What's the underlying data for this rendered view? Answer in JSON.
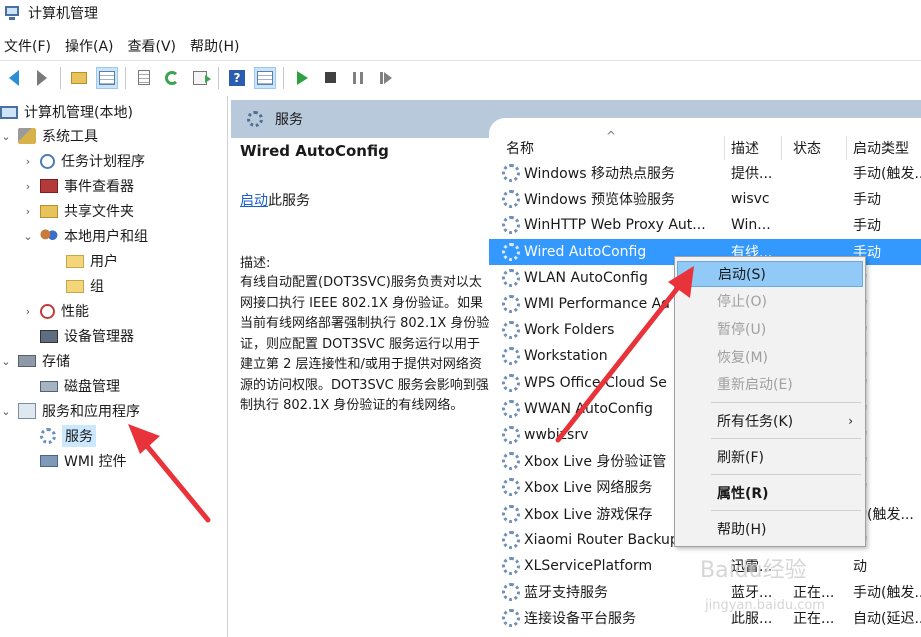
{
  "window": {
    "title": "计算机管理"
  },
  "menu": [
    "文件(F)",
    "操作(A)",
    "查看(V)",
    "帮助(H)"
  ],
  "tree": {
    "root": "计算机管理(本地)",
    "system_tools": "系统工具",
    "task_scheduler": "任务计划程序",
    "event_viewer": "事件查看器",
    "shared_folders": "共享文件夹",
    "local_users": "本地用户和组",
    "users": "用户",
    "groups": "组",
    "performance": "性能",
    "device_manager": "设备管理器",
    "storage": "存储",
    "disk_management": "磁盘管理",
    "services_apps": "服务和应用程序",
    "services": "服务",
    "wmi": "WMI 控件"
  },
  "header": {
    "title": "服务"
  },
  "detail": {
    "name": "Wired AutoConfig",
    "start_link": "启动",
    "start_suffix": "此服务",
    "desc_label": "描述:",
    "desc": "有线自动配置(DOT3SVC)服务负责对以太网接口执行 IEEE 802.1X 身份验证。如果当前有线网络部署强制执行 802.1X 身份验证，则应配置 DOT3SVC 服务运行以用于建立第 2 层连接性和/或用于提供对网络资源的访问权限。DOT3SVC 服务会影响到强制执行 802.1X 身份验证的有线网络。"
  },
  "columns": {
    "name": "名称",
    "desc": "描述",
    "status": "状态",
    "startup": "启动类型"
  },
  "services": [
    {
      "name": "Windows 移动热点服务",
      "desc": "提供...",
      "status": "",
      "startup": "手动(触发..."
    },
    {
      "name": "Windows 预览体验服务",
      "desc": "wisvc",
      "status": "",
      "startup": "手动"
    },
    {
      "name": "WinHTTP Web Proxy Aut...",
      "desc": "Win...",
      "status": "",
      "startup": "手动"
    },
    {
      "name": "Wired AutoConfig",
      "desc": "有线...",
      "status": "",
      "startup": "手动"
    },
    {
      "name": "WLAN AutoConfig",
      "desc": "",
      "status": "",
      "startup": "动"
    },
    {
      "name": "WMI Performance Ad",
      "desc": "",
      "status": "",
      "startup": "动"
    },
    {
      "name": "Work Folders",
      "desc": "",
      "status": "",
      "startup": "动"
    },
    {
      "name": "Workstation",
      "desc": "",
      "status": "",
      "startup": "动"
    },
    {
      "name": "WPS Office Cloud Se",
      "desc": "",
      "status": "",
      "startup": "动"
    },
    {
      "name": "WWAN AutoConfig",
      "desc": "",
      "status": "",
      "startup": "动"
    },
    {
      "name": "wwbizsrv",
      "desc": "",
      "status": "",
      "startup": "动"
    },
    {
      "name": "Xbox Live 身份验证管",
      "desc": "",
      "status": "",
      "startup": "动"
    },
    {
      "name": "Xbox Live 网络服务",
      "desc": "",
      "status": "",
      "startup": "动"
    },
    {
      "name": "Xbox Live 游戏保存",
      "desc": "",
      "status": "",
      "startup": "动(触发..."
    },
    {
      "name": "Xiaomi Router Backup",
      "desc": "",
      "status": "",
      "startup": "动"
    },
    {
      "name": "XLServicePlatform",
      "desc": "迅雷...",
      "status": "",
      "startup": "动"
    },
    {
      "name": "蓝牙支持服务",
      "desc": "蓝牙...",
      "status": "正在...",
      "startup": "手动(触发..."
    },
    {
      "name": "连接设备平台服务",
      "desc": "此服...",
      "status": "正在...",
      "startup": "自动(延迟..."
    }
  ],
  "context_menu": {
    "start": "启动(S)",
    "stop": "停止(O)",
    "pause": "暂停(U)",
    "resume": "恢复(M)",
    "restart": "重新启动(E)",
    "all_tasks": "所有任务(K)",
    "refresh": "刷新(F)",
    "properties": "属性(R)",
    "help": "帮助(H)"
  },
  "watermark": {
    "main": "Baidu经验",
    "sub": "jingyan.baidu.com"
  },
  "colors": {
    "selection": "#3399ff",
    "header": "#b8c9db",
    "menu_highlight": "#91c9f7",
    "annotation": "#e8333a"
  }
}
